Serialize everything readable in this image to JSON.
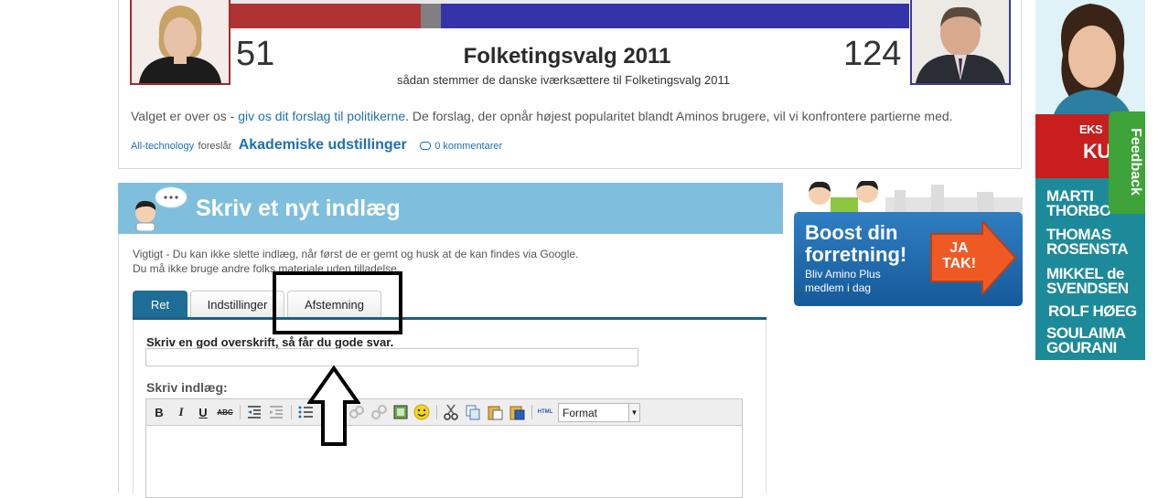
{
  "election": {
    "seats_left": "51",
    "seats_right": "124",
    "title": "Folketingsvalg 2011",
    "subtitle": "sådan stemmer de danske iværksættere til Folketingsvalg 2011",
    "intro_before": "Valget er over os - ",
    "intro_link": "giv os dit forslag til politikerne",
    "intro_after": ". De forslag, der opnår højest popularitet blandt Aminos brugere, vil vi konfrontere partierne med.",
    "colors": {
      "left_bloc": "#b03333",
      "undecided": "#808080",
      "right_bloc": "#3434a8"
    }
  },
  "suggestion": {
    "user": "All-technology",
    "verb": "foreslår",
    "title": "Akademiske udstillinger",
    "comments": "0 kommentarer"
  },
  "post_form": {
    "header_title": "Skriv et nyt indlæg",
    "warning_line1": "Vigtigt - Du kan ikke slette indlæg, når først de er gemt og husk at de kan findes via Google.",
    "warning_line2": "Du må ikke bruge andre folks materiale uden tilladelse.",
    "tabs": [
      {
        "label": "Ret",
        "active": true
      },
      {
        "label": "Indstillinger",
        "active": false
      },
      {
        "label": "Afstemning",
        "active": false
      }
    ],
    "headline_label": "Skriv en god overskrift, så får du gode svar.",
    "headline_value": "",
    "body_label": "Skriv indlæg:",
    "toolbar": {
      "bold": "B",
      "italic": "I",
      "underline": "U",
      "strike": "ABC",
      "html": "HTML",
      "format": "Format"
    }
  },
  "ads": {
    "boost_line1": "Boost din",
    "boost_line2": "forretning!",
    "boost_sub1": "Bliv Amino Plus",
    "boost_sub2": "medlem i dag",
    "boost_cta1": "JA",
    "boost_cta2": "TAK!",
    "side_lines": [
      "EKS",
      "KU",
      "MARTI",
      "THORBO",
      "THOMAS",
      "ROSENSTA",
      "MIKKEL de",
      "SVENDSEN",
      "ROLF HØEG",
      "SOULAIMA",
      "GOURANI"
    ]
  },
  "feedback": {
    "label": "Feedback"
  }
}
